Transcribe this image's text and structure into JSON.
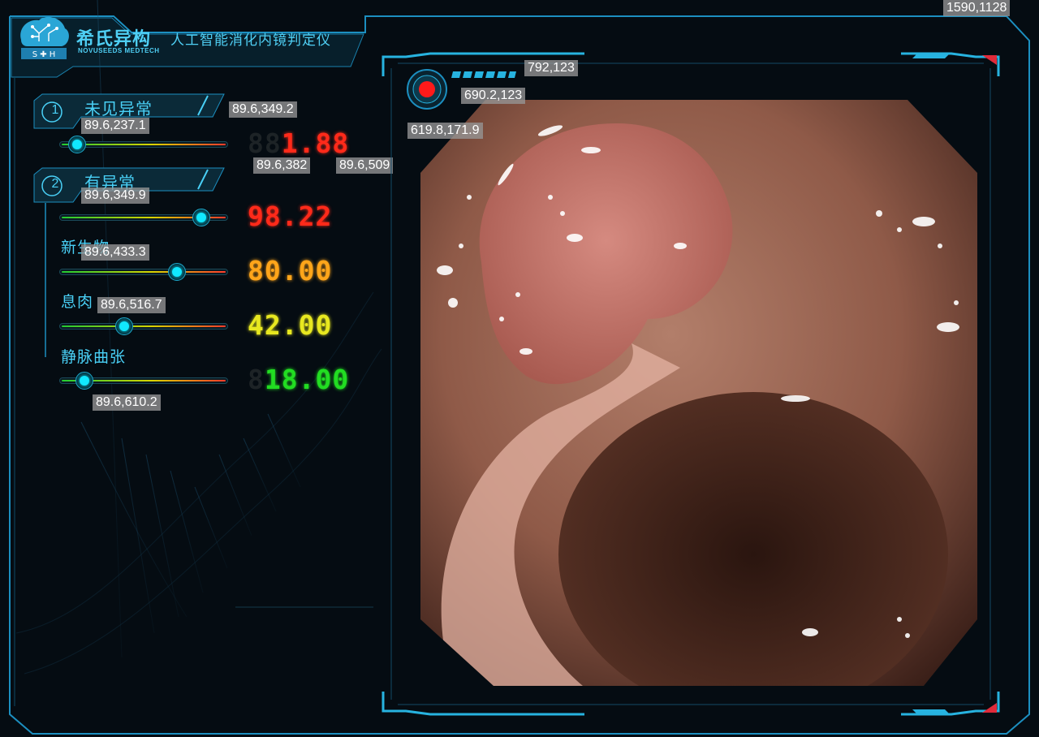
{
  "header": {
    "brand_name": "希氏异构",
    "brand_sub": "NOVUSEEDS MEDTECH",
    "app_title": "人工智能消化内镜判定仪",
    "corner_coord": "1590,1128"
  },
  "panel": {
    "section1": {
      "num": "1",
      "label": "未见异常",
      "coord_a": "89.6,349.2",
      "coord_b": "89.6,237.1"
    },
    "readout1": {
      "dim": "88",
      "value": "1.88",
      "color": "#ff2a1a",
      "level": 0.06,
      "coord_a": "89.6,382",
      "coord_b": "89.6,509"
    },
    "section2": {
      "num": "2",
      "label": "有异常",
      "coord_a": "89.6,349.9"
    },
    "readout2": {
      "value": "98.22",
      "color": "#ff2a1a",
      "level": 0.88
    },
    "item_neoplasm": {
      "label": "新生物",
      "coord": "89.6,433.3",
      "value": "80.00",
      "color": "#ffa51a",
      "level": 0.72
    },
    "item_polyp": {
      "label": "息肉",
      "coord": "89.6,516.7",
      "value": "42.00",
      "color": "#e8e820",
      "level": 0.37
    },
    "item_varix": {
      "label": "静脉曲张",
      "dim": "8",
      "value": "18.00",
      "color": "#22dd22",
      "level": 0.11,
      "coord": "89.6,610.2"
    }
  },
  "viewer": {
    "coord_rec": "619.8,171.9",
    "coord_bars_a": "792,123",
    "coord_bars_b": "690.2,123"
  },
  "colors": {
    "accent": "#27b3e0",
    "frame": "#1c8fc0",
    "background": "#050c12"
  },
  "icons": [
    "brain-circuit-logo-icon",
    "record-icon",
    "signal-bars-icon"
  ]
}
